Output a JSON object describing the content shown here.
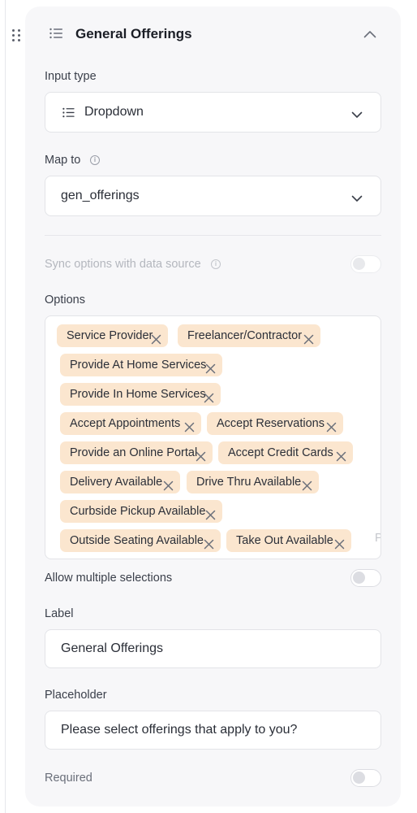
{
  "header": {
    "title": "General Offerings"
  },
  "input_type": {
    "label": "Input type",
    "value": "Dropdown"
  },
  "map_to": {
    "label": "Map to",
    "value": "gen_offerings"
  },
  "sync": {
    "label": "Sync options with data source",
    "enabled": false
  },
  "options": {
    "label": "Options",
    "items": [
      "Service Provider",
      "Freelancer/Contractor",
      "Provide At Home Services",
      "Provide In Home Services",
      "Accept Appointments",
      "Accept Reservations",
      "Provide an Online Portal",
      "Accept Credit Cards",
      "Delivery Available",
      "Drive Thru Available",
      "Curbside Pickup Available",
      "Outside Seating Available",
      "Take Out Available"
    ],
    "input_placeholder": "Pl"
  },
  "allow_multiple": {
    "label": "Allow multiple selections",
    "enabled": false
  },
  "label_field": {
    "label": "Label",
    "value": "General Offerings"
  },
  "placeholder_field": {
    "label": "Placeholder",
    "value": "Please select offerings that apply to you?"
  },
  "required": {
    "label": "Required",
    "enabled": false
  },
  "colors": {
    "chip_bg": "#fbe6cf",
    "card_bg": "#f7f7f9"
  }
}
